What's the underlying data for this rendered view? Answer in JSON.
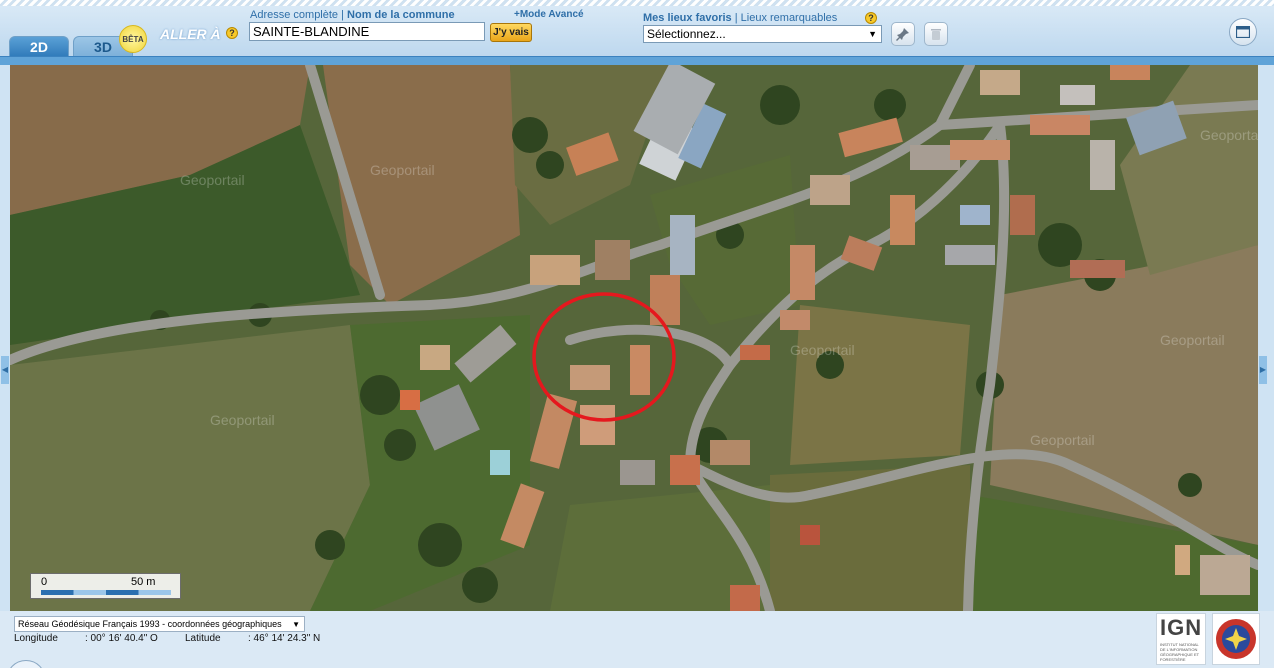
{
  "tabs": {
    "tab_2d": "2D",
    "tab_3d": "3D",
    "beta_badge": "BÊTA"
  },
  "goto": {
    "label": "ALLER À",
    "link_full_address": "Adresse complète",
    "separator": " | ",
    "link_commune": "Nom de la commune",
    "advanced_mode": "+Mode Avancé",
    "input_value": "SAINTE-BLANDINE",
    "go_button": "J'y vais"
  },
  "favorites": {
    "link_favorites": "Mes lieux favoris",
    "separator": " | ",
    "link_remarkable": "Lieux remarquables",
    "select_value": "Sélectionnez..."
  },
  "help_icon": "?",
  "icons": {
    "help": "help-icon",
    "pin": "pin-icon",
    "trash": "trash-icon",
    "window": "window-icon",
    "dropdown": "chevron-down-icon",
    "left_handle": "chevron-left-icon",
    "right_handle": "chevron-right-icon"
  },
  "map": {
    "watermark": "Geoportail",
    "marker_color": "#e5181e"
  },
  "scale": {
    "zero": "0",
    "distance": "50 m"
  },
  "coordinates": {
    "system": "Réseau Géodésique Français 1993 - coordonnées géographiques",
    "longitude_label": "Longitude",
    "longitude_value": ": 00° 16' 40.4\" O",
    "latitude_label": "Latitude",
    "latitude_value": ": 46° 14' 24.3\" N"
  },
  "logos": {
    "ign_text": "IGN",
    "ign_subtitle": "INSTITUT NATIONAL DE L'INFORMATION GÉOGRAPHIQUE ET FORESTIÈRE"
  },
  "colors": {
    "toolbar_blue": "#5fa3d8",
    "accent_yellow": "#f7c92a",
    "link_blue": "#2f6fa8"
  }
}
